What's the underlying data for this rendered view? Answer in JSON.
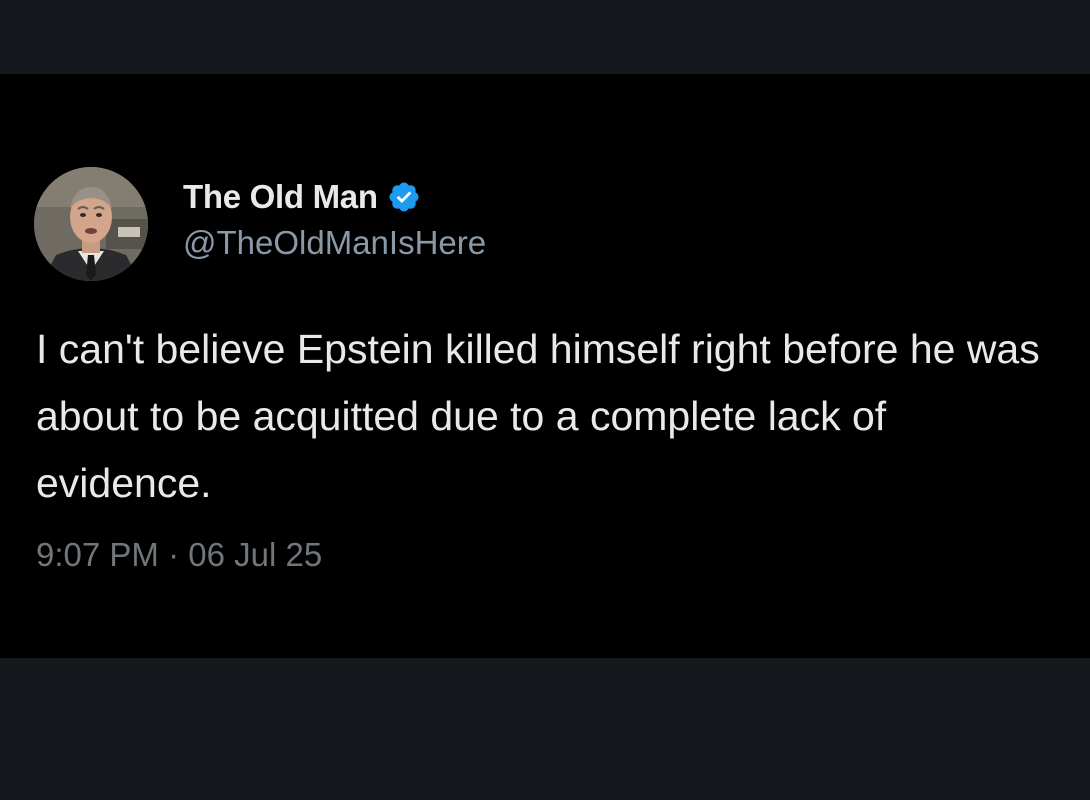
{
  "tweet": {
    "author": {
      "display_name": "The Old Man",
      "handle": "@TheOldManIsHere",
      "verified": true,
      "avatar_icon": "profile-photo-man-in-suit"
    },
    "text": "I can't believe Epstein killed himself right before he was about to be acquitted due to a complete lack of evidence.",
    "time": "9:07 PM",
    "separator": "·",
    "date": "06 Jul 25"
  },
  "colors": {
    "background": "#000000",
    "frame": "#15181c",
    "text_primary": "#e7e9ea",
    "text_secondary": "#8b98a5",
    "verified_badge": "#1d9bf0"
  }
}
